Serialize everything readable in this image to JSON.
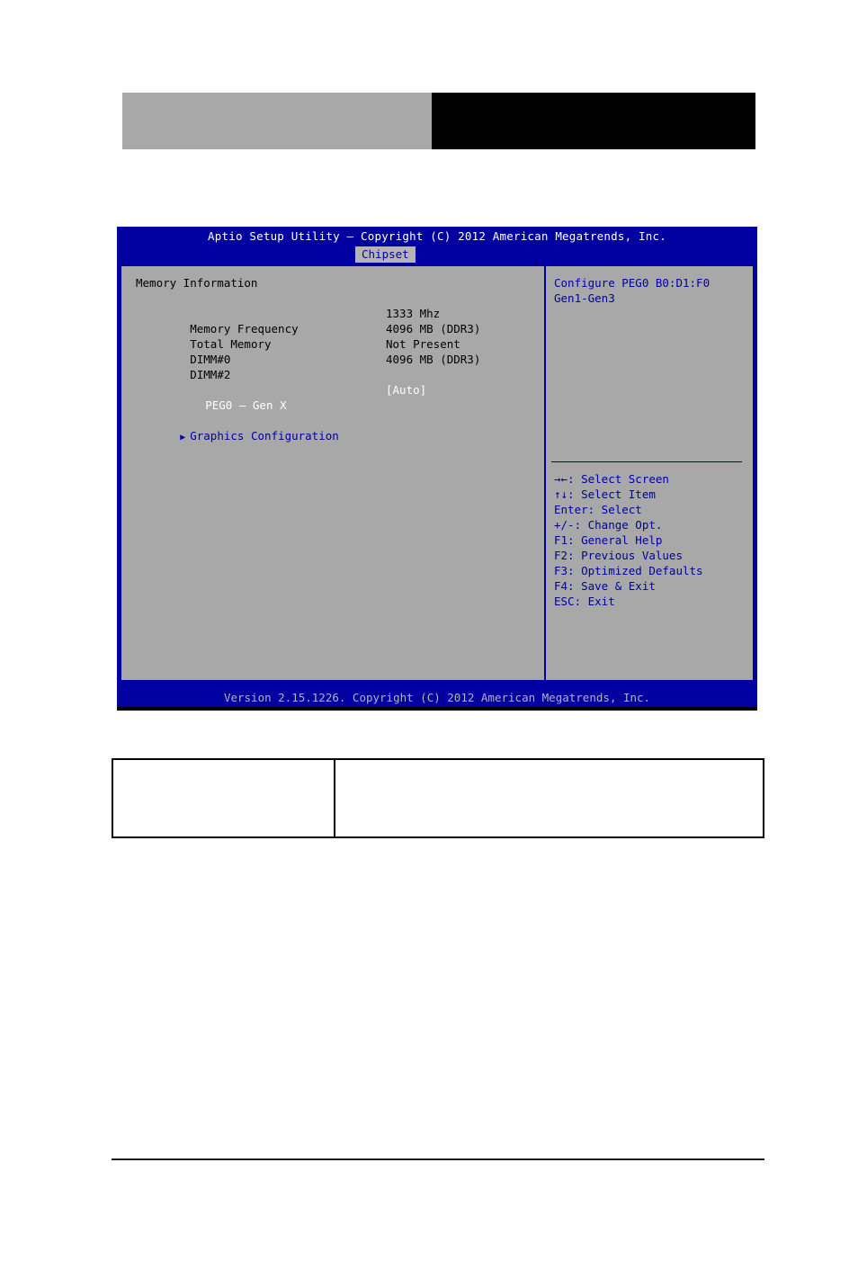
{
  "page": {
    "header_blocks": {
      "left_block_color": "#a8a8a8",
      "right_block_color": "#000000"
    }
  },
  "bios": {
    "title": "Aptio Setup Utility – Copyright (C) 2012 American Megatrends, Inc.",
    "active_tab": "Chipset",
    "version_bar": "Version 2.15.1226. Copyright (C) 2012 American Megatrends, Inc.",
    "colors": {
      "window_blue": "#0000a0",
      "body_gray": "#a8a8a8",
      "tab_gray": "#b4b4b4",
      "text_white": "#ffffff",
      "text_black": "#000000",
      "text_blue": "#0000a0"
    },
    "settings": {
      "section_title": "Memory Information",
      "rows": [
        {
          "label": "Memory Frequency",
          "value": "1333 Mhz"
        },
        {
          "label": "Total Memory",
          "value": "4096 MB (DDR3)"
        },
        {
          "label": "DIMM#0",
          "value": "Not Present"
        },
        {
          "label": "DIMM#2",
          "value": "4096 MB (DDR3)"
        }
      ],
      "selected_option": {
        "label": "PEG0 – Gen X",
        "value": "[Auto]"
      },
      "submenu": {
        "arrow": "submenu-arrow-icon",
        "label": "Graphics Configuration"
      }
    },
    "help": {
      "lines": [
        "Configure PEG0 B0:D1:F0",
        "Gen1-Gen3"
      ]
    },
    "key_legend": [
      "→←: Select Screen",
      "↑↓: Select Item",
      "Enter: Select",
      "+/-: Change Opt.",
      "F1: General Help",
      "F2: Previous Values",
      "F3: Optimized Defaults",
      "F4: Save & Exit",
      "ESC: Exit"
    ]
  },
  "info_table": {
    "left_cell": "",
    "right_cell": ""
  }
}
